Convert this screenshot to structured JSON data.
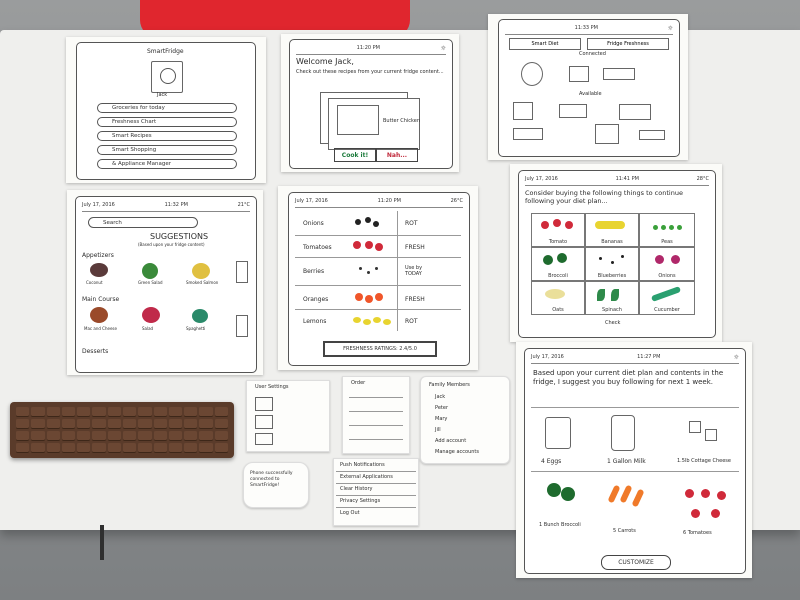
{
  "scene": {
    "table_color": "#efefed",
    "chair_color": "#e0262e",
    "keyboard_color": "#5a3b2a"
  },
  "sheet_profile": {
    "app_name": "SmartFridge",
    "username": "Jack",
    "menu": [
      "Groceries for today",
      "Freshness Chart",
      "Smart Recipes",
      "Smart Shopping",
      "& Appliance Manager"
    ]
  },
  "sheet_welcome": {
    "time": "11:20 PM",
    "greeting": "Welcome Jack,",
    "subtitle": "Check out these recipes from your current fridge content...",
    "recipe_name": "Butter Chicken",
    "cook_button": "Cook it!",
    "nah_button": "Nah..."
  },
  "sheet_appliances": {
    "time": "11:33 PM",
    "tabs": [
      "Smart Diet",
      "Fridge Freshness"
    ],
    "label_connected": "Connected",
    "label_available": "Available"
  },
  "sheet_search": {
    "date": "July 17, 2016",
    "time": "11:32 PM",
    "temp": "21°C",
    "search_placeholder": "Search",
    "suggestions_title": "SUGGESTIONS",
    "suggestions_sub": "(Based upon your fridge content)",
    "section_appetizers": "Appetizers",
    "appetizers": [
      "Coconut",
      "Green Salad",
      "Smoked Salmon"
    ],
    "section_main": "Main Course",
    "mains": [
      "Mac and Cheese",
      "Salad",
      "Spaghetti"
    ],
    "section_desserts": "Desserts"
  },
  "sheet_freshness": {
    "date": "July 17, 2016",
    "time": "11:20 PM",
    "temp": "26°C",
    "rows": [
      {
        "item": "Onions",
        "status": "ROT"
      },
      {
        "item": "Tomatoes",
        "status": "FRESH"
      },
      {
        "item": "Berries",
        "status": "Use by TODAY"
      },
      {
        "item": "Oranges",
        "status": "FRESH"
      },
      {
        "item": "Lemons",
        "status": "ROT"
      }
    ],
    "ratings_button": "FRESHNESS RATINGS: 2.4/5.0"
  },
  "sheet_consider": {
    "date": "July 17, 2016",
    "time": "11:41 PM",
    "temp": "28°C",
    "text": "Consider buying the following things to continue following your diet plan...",
    "items": [
      "Tomato",
      "Bananas",
      "Peas",
      "Broccoli",
      "Blueberries",
      "Onions",
      "Oats",
      "Spinach",
      "Cucumber"
    ],
    "check_label": "Check"
  },
  "sheet_shopping": {
    "date": "July 17, 2016",
    "time": "11:27 PM",
    "text": "Based upon your current diet plan and contents in the fridge, I suggest you buy following for next 1 week.",
    "items": [
      "4 Eggs",
      "1 Gallon Milk",
      "1.5lb Cottage Cheese",
      "1 Bunch Broccoli",
      "5 Carrots",
      "6 Tomatoes"
    ],
    "customize_button": "CUSTOMIZE"
  },
  "notes": {
    "user_settings": "User Settings",
    "order_title": "Order",
    "family_title": "Family Members",
    "family": [
      "Jack",
      "Peter",
      "Mary",
      "Jill"
    ],
    "add_account": "Add account",
    "manage_accounts": "Manage accounts",
    "toast": "Phone successfully connected to SmartFridge!",
    "settings_menu": [
      "Push Notifications",
      "External Applications",
      "Clear History",
      "Privacy Settings",
      "Log Out"
    ]
  }
}
